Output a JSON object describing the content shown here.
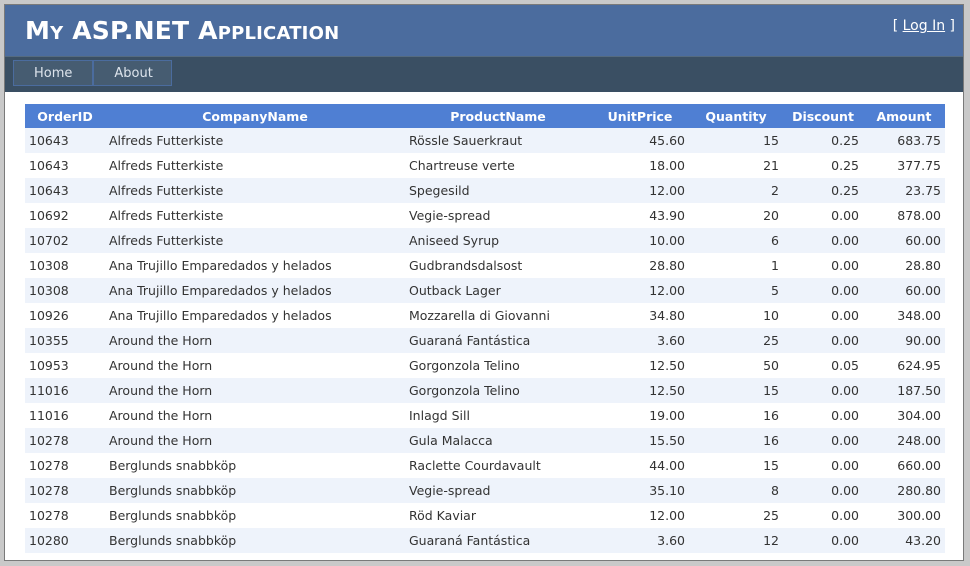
{
  "header": {
    "title": "My ASP.NET Application",
    "login_prefix": "[ ",
    "login_label": "Log In",
    "login_suffix": " ]"
  },
  "menu": {
    "items": [
      {
        "label": "Home"
      },
      {
        "label": "About"
      }
    ]
  },
  "table": {
    "columns": [
      "OrderID",
      "CompanyName",
      "ProductName",
      "UnitPrice",
      "Quantity",
      "Discount",
      "Amount"
    ],
    "rows": [
      [
        "10643",
        "Alfreds Futterkiste",
        "Rössle Sauerkraut",
        "45.60",
        "15",
        "0.25",
        "683.75"
      ],
      [
        "10643",
        "Alfreds Futterkiste",
        "Chartreuse verte",
        "18.00",
        "21",
        "0.25",
        "377.75"
      ],
      [
        "10643",
        "Alfreds Futterkiste",
        "Spegesild",
        "12.00",
        "2",
        "0.25",
        "23.75"
      ],
      [
        "10692",
        "Alfreds Futterkiste",
        "Vegie-spread",
        "43.90",
        "20",
        "0.00",
        "878.00"
      ],
      [
        "10702",
        "Alfreds Futterkiste",
        "Aniseed Syrup",
        "10.00",
        "6",
        "0.00",
        "60.00"
      ],
      [
        "10308",
        "Ana Trujillo Emparedados y helados",
        "Gudbrandsdalsost",
        "28.80",
        "1",
        "0.00",
        "28.80"
      ],
      [
        "10308",
        "Ana Trujillo Emparedados y helados",
        "Outback Lager",
        "12.00",
        "5",
        "0.00",
        "60.00"
      ],
      [
        "10926",
        "Ana Trujillo Emparedados y helados",
        "Mozzarella di Giovanni",
        "34.80",
        "10",
        "0.00",
        "348.00"
      ],
      [
        "10355",
        "Around the Horn",
        "Guaraná Fantástica",
        "3.60",
        "25",
        "0.00",
        "90.00"
      ],
      [
        "10953",
        "Around the Horn",
        "Gorgonzola Telino",
        "12.50",
        "50",
        "0.05",
        "624.95"
      ],
      [
        "11016",
        "Around the Horn",
        "Gorgonzola Telino",
        "12.50",
        "15",
        "0.00",
        "187.50"
      ],
      [
        "11016",
        "Around the Horn",
        "Inlagd Sill",
        "19.00",
        "16",
        "0.00",
        "304.00"
      ],
      [
        "10278",
        "Around the Horn",
        "Gula Malacca",
        "15.50",
        "16",
        "0.00",
        "248.00"
      ],
      [
        "10278",
        "Berglunds snabbköp",
        "Raclette Courdavault",
        "44.00",
        "15",
        "0.00",
        "660.00"
      ],
      [
        "10278",
        "Berglunds snabbköp",
        "Vegie-spread",
        "35.10",
        "8",
        "0.00",
        "280.80"
      ],
      [
        "10278",
        "Berglunds snabbköp",
        "Röd Kaviar",
        "12.00",
        "25",
        "0.00",
        "300.00"
      ],
      [
        "10280",
        "Berglunds snabbköp",
        "Guaraná Fantástica",
        "3.60",
        "12",
        "0.00",
        "43.20"
      ]
    ]
  },
  "colors": {
    "header_bg": "#4b6c9e",
    "menu_bg": "#3a4f63",
    "table_header_bg": "#4f7fd3",
    "row_alt_bg": "#eef3fb"
  }
}
